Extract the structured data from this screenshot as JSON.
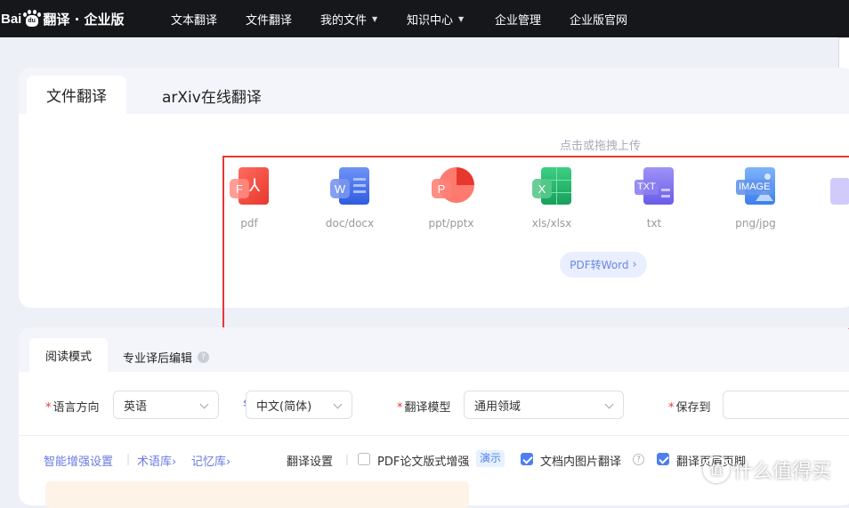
{
  "nav": {
    "brand_bai": "Bai",
    "brand_du": "du",
    "brand_text": "翻译 · 企业版",
    "items": [
      {
        "label": "文本翻译",
        "has_caret": false
      },
      {
        "label": "文件翻译",
        "has_caret": false
      },
      {
        "label": "我的文件",
        "has_caret": true
      },
      {
        "label": "知识中心",
        "has_caret": true
      },
      {
        "label": "企业管理",
        "has_caret": false
      },
      {
        "label": "企业版官网",
        "has_caret": false
      }
    ]
  },
  "upload": {
    "tabs": [
      "文件翻译",
      "arXiv在线翻译"
    ],
    "hint": "点击或拖拽上传",
    "file_types": [
      {
        "label": "pdf",
        "badge": "F",
        "icon": "pdf-icon",
        "color": "#f04a3f"
      },
      {
        "label": "doc/docx",
        "badge": "W",
        "icon": "word-icon",
        "color": "#3f6be8"
      },
      {
        "label": "ppt/pptx",
        "badge": "P",
        "icon": "powerpoint-icon",
        "color": "#f0564a"
      },
      {
        "label": "xls/xlsx",
        "badge": "X",
        "icon": "excel-icon",
        "color": "#1fae63"
      },
      {
        "label": "txt",
        "badge": "TXT",
        "icon": "txt-icon",
        "color": "#7b6ff0"
      },
      {
        "label": "png/jpg",
        "badge": "IMAGE",
        "icon": "image-icon",
        "color": "#4a8ff0"
      }
    ],
    "pdf_to_word": "PDF转Word"
  },
  "settings": {
    "mode_tabs": [
      "阅读模式",
      "专业译后编辑"
    ],
    "lang_direction_label": "语言方向",
    "source_lang": "英语",
    "target_lang": "中文(简体)",
    "model_label": "翻译模型",
    "model_value": "通用领域",
    "save_label": "保存到",
    "links": [
      "智能增强设置",
      "术语库",
      "记忆库"
    ],
    "translate_settings": "翻译设置",
    "options": [
      {
        "label": "PDF论文版式增强",
        "checked": false
      },
      {
        "label": "文档内图片翻译",
        "checked": true
      },
      {
        "label": "翻译页眉页脚",
        "checked": true
      }
    ],
    "demo": "演示"
  },
  "watermark": {
    "text": "什么值得买",
    "logo": "值"
  },
  "colors": {
    "accent": "#4f7ef2",
    "nav_bg": "#16171b",
    "required": "#e53935",
    "highlight_frame": "#e53935"
  }
}
